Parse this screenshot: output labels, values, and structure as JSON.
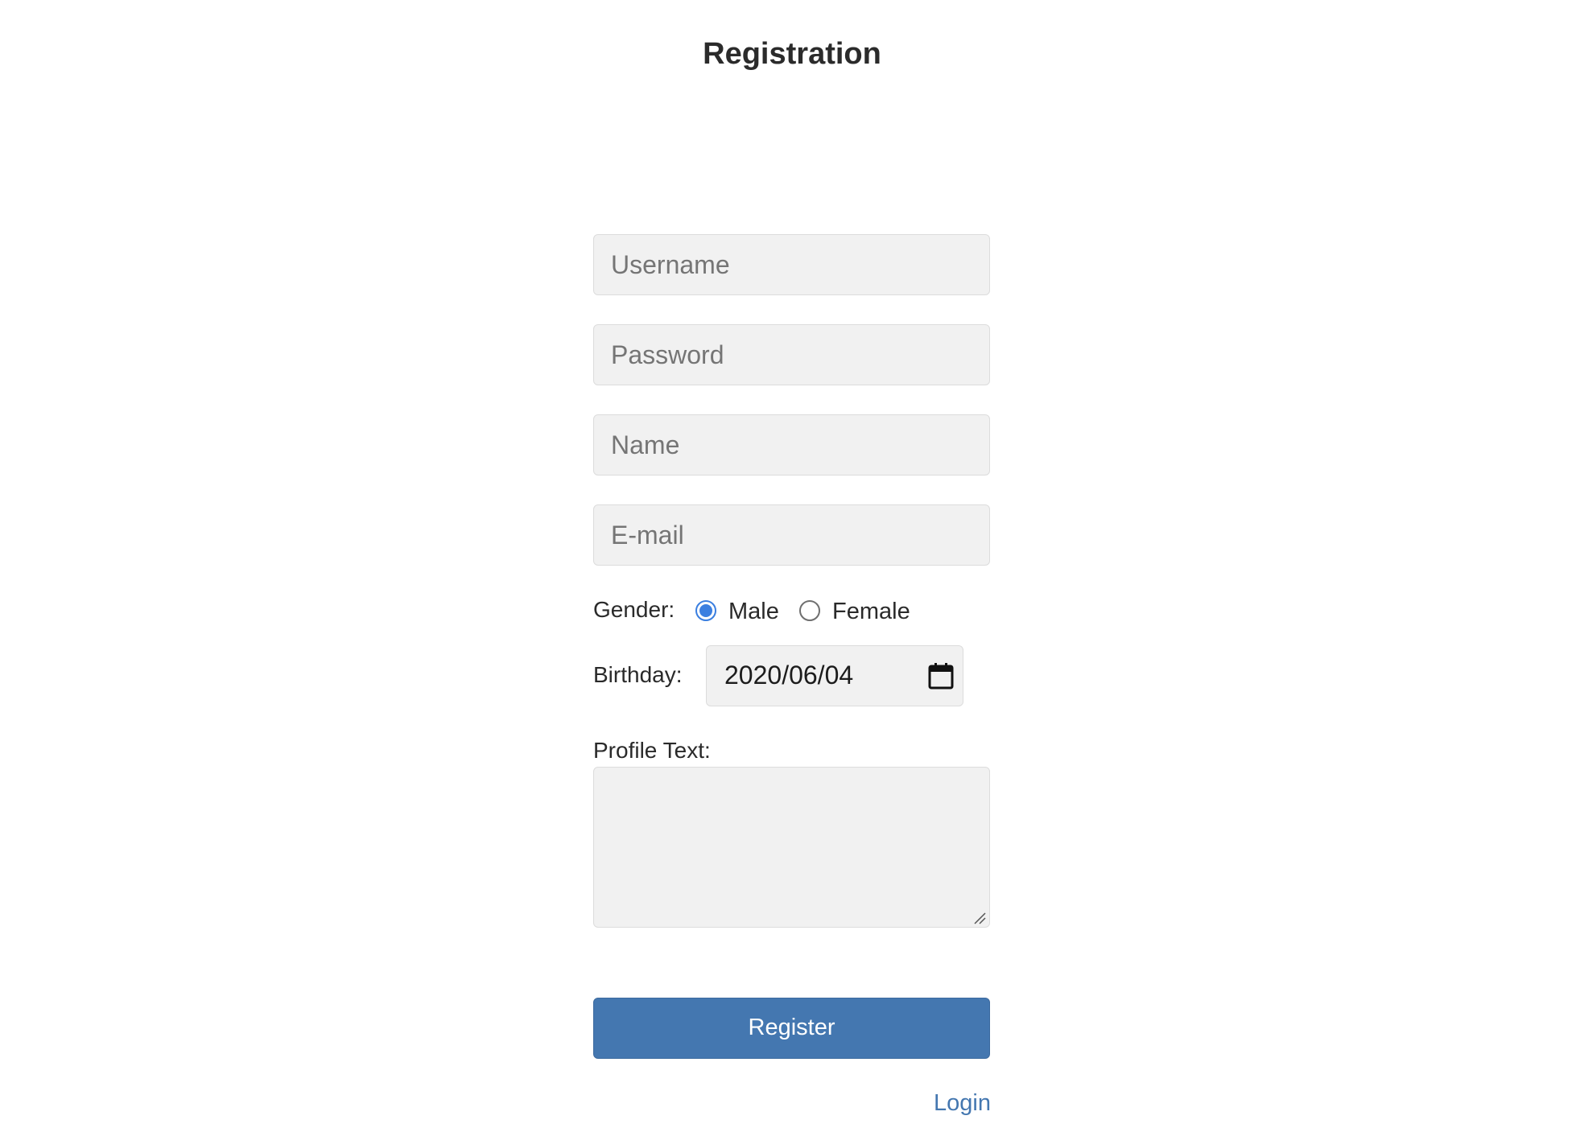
{
  "page": {
    "title": "Registration"
  },
  "form": {
    "username": {
      "value": "",
      "placeholder": "Username"
    },
    "password": {
      "value": "",
      "placeholder": "Password"
    },
    "name": {
      "value": "",
      "placeholder": "Name"
    },
    "email": {
      "value": "",
      "placeholder": "E-mail"
    },
    "gender": {
      "label": "Gender:",
      "options": [
        {
          "label": "Male",
          "selected": true
        },
        {
          "label": "Female",
          "selected": false
        }
      ]
    },
    "birthday": {
      "label": "Birthday:",
      "value": "2020/06/04",
      "icon": "calendar-icon"
    },
    "profile_text": {
      "label": "Profile Text:",
      "value": ""
    },
    "register_label": "Register",
    "login_label": "Login"
  },
  "colors": {
    "accent": "#4477b0",
    "radio_selected": "#3b7fe0",
    "field_background": "#f1f1f1"
  }
}
